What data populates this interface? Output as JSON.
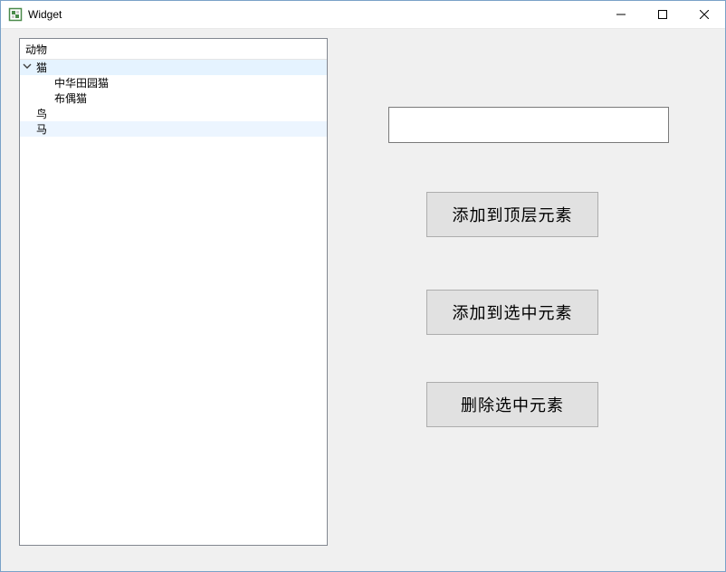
{
  "window": {
    "title": "Widget"
  },
  "tree": {
    "header": "动物",
    "items": [
      {
        "label": "猫",
        "depth": 0,
        "expanded": true,
        "hasChildren": true,
        "state": "selected"
      },
      {
        "label": "中华田园猫",
        "depth": 1,
        "expanded": false,
        "hasChildren": false,
        "state": ""
      },
      {
        "label": "布偶猫",
        "depth": 1,
        "expanded": false,
        "hasChildren": false,
        "state": ""
      },
      {
        "label": "鸟",
        "depth": 0,
        "expanded": false,
        "hasChildren": false,
        "state": ""
      },
      {
        "label": "马",
        "depth": 0,
        "expanded": false,
        "hasChildren": false,
        "state": "highlight"
      }
    ]
  },
  "input": {
    "value": ""
  },
  "buttons": {
    "add_top": "添加到顶层元素",
    "add_selected": "添加到选中元素",
    "delete_selected": "删除选中元素"
  }
}
